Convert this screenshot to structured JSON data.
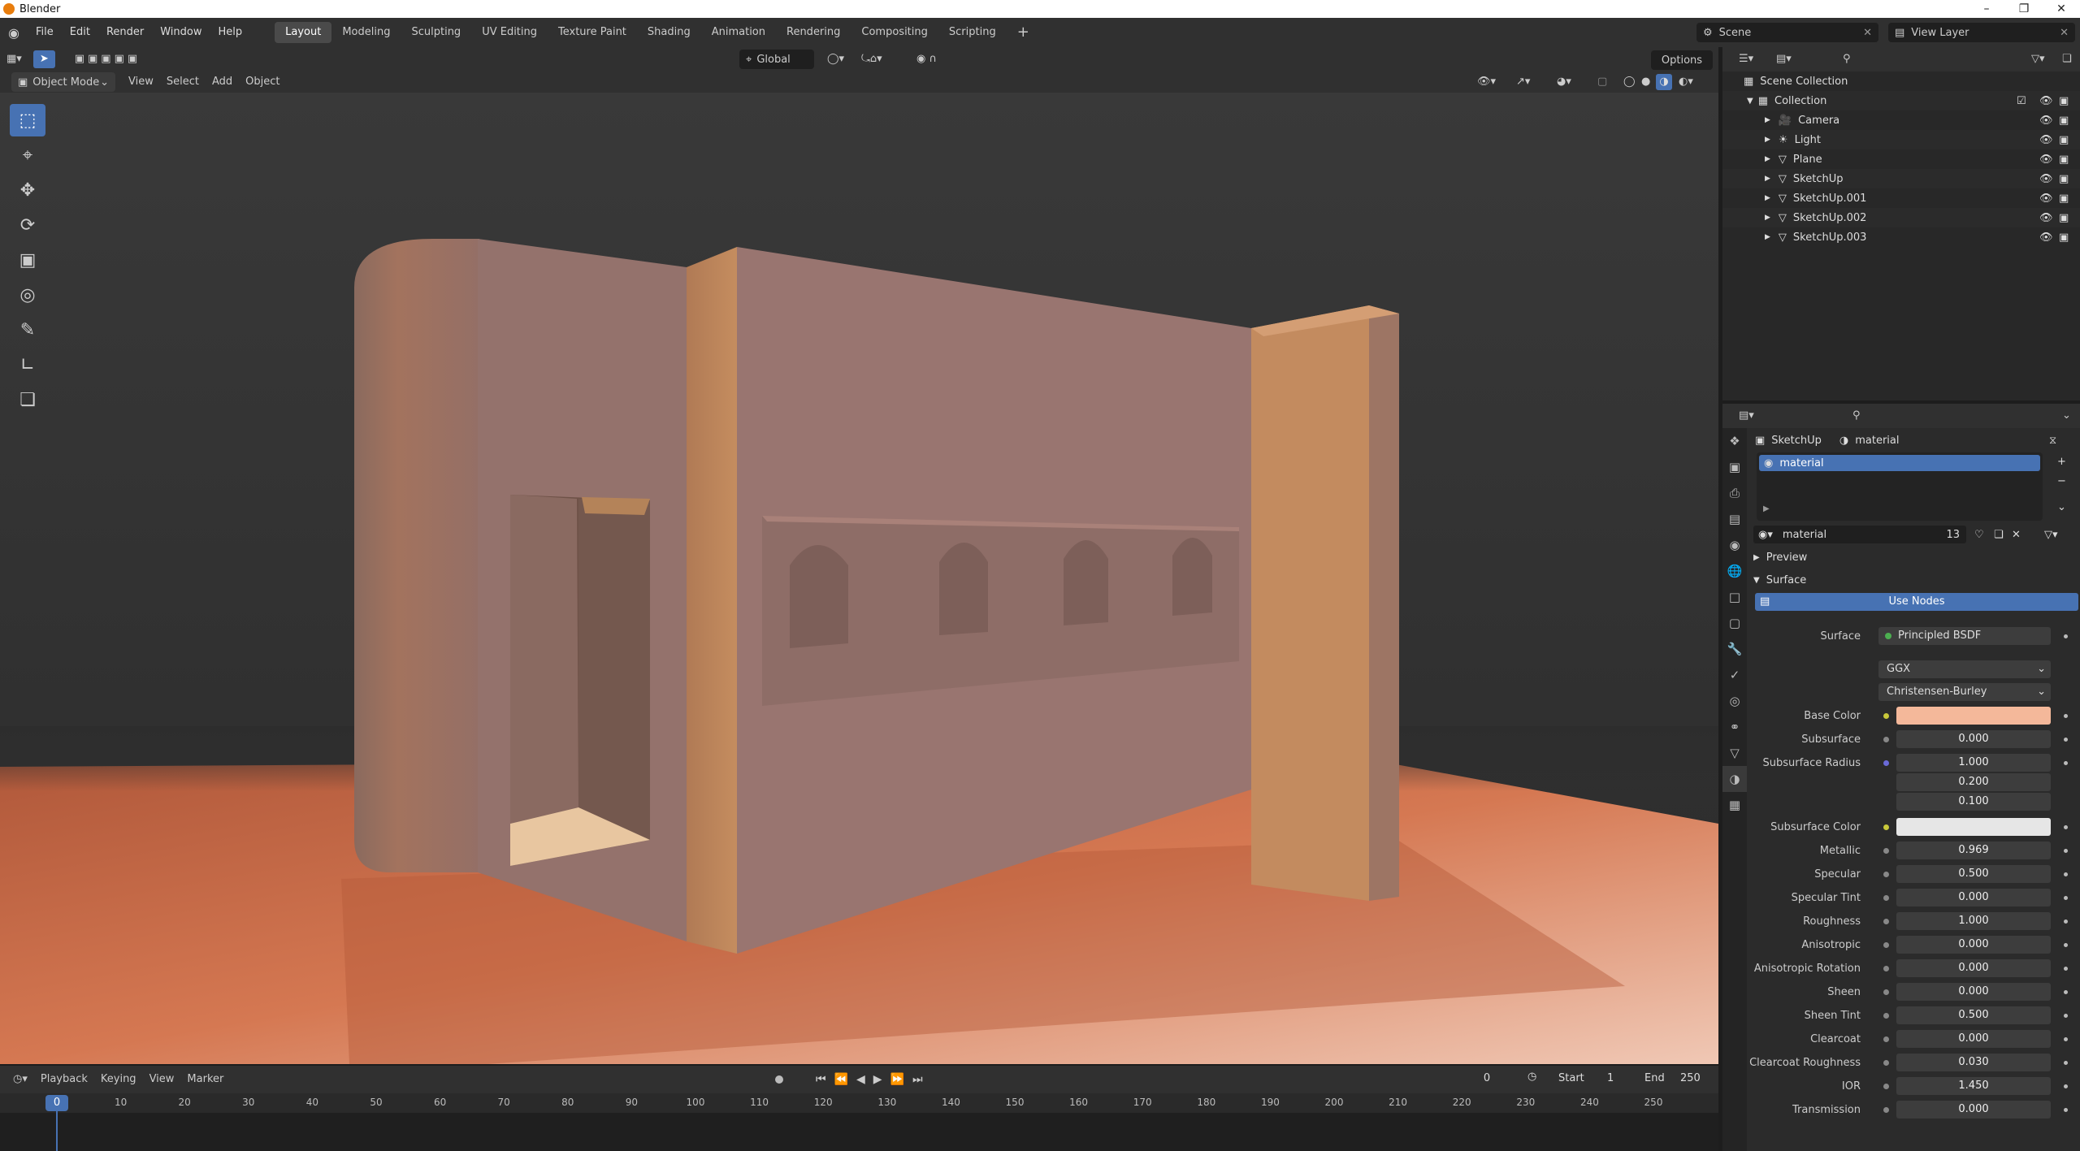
{
  "app": {
    "title": "Blender"
  },
  "menu": [
    "File",
    "Edit",
    "Render",
    "Window",
    "Help"
  ],
  "workspaces": [
    "Layout",
    "Modeling",
    "Sculpting",
    "UV Editing",
    "Texture Paint",
    "Shading",
    "Animation",
    "Rendering",
    "Compositing",
    "Scripting"
  ],
  "active_workspace": "Layout",
  "scene": {
    "label": "Scene",
    "view_layer": "View Layer"
  },
  "viewport": {
    "mode": "Object Mode",
    "menus": [
      "View",
      "Select",
      "Add",
      "Object"
    ],
    "transform_orientation": "Global",
    "options_label": "Options"
  },
  "timeline": {
    "menus": [
      "Playback",
      "Keying",
      "View",
      "Marker"
    ],
    "current_frame": "0",
    "start_label": "Start",
    "start_value": "1",
    "end_label": "End",
    "end_value": "250",
    "playhead": "0",
    "ticks": [
      "10",
      "20",
      "30",
      "40",
      "50",
      "60",
      "70",
      "80",
      "90",
      "100",
      "110",
      "120",
      "130",
      "140",
      "150",
      "160",
      "170",
      "180",
      "190",
      "200",
      "210",
      "220",
      "230",
      "240",
      "250"
    ]
  },
  "outliner": {
    "scene_collection": "Scene Collection",
    "collection": "Collection",
    "items": [
      "Camera",
      "Light",
      "Plane",
      "SketchUp",
      "SketchUp.001",
      "SketchUp.002",
      "SketchUp.003"
    ]
  },
  "properties": {
    "breadcrumb_object": "SketchUp",
    "breadcrumb_material": "material",
    "slot_name": "material",
    "material_name": "material",
    "users": "13",
    "panels": {
      "preview": "Preview",
      "surface": "Surface"
    },
    "use_nodes": "Use Nodes",
    "surface_label": "Surface",
    "surface_shader": "Principled BSDF",
    "distribution": "GGX",
    "subsurface_method": "Christensen-Burley",
    "base_color_label": "Base Color",
    "base_color": "#f4b89a",
    "subsurface_color_label": "Subsurface Color",
    "subsurface_color": "#e6e6e6",
    "subsurface_radius_label": "Subsurface Radius",
    "subsurface_radius": [
      "1.000",
      "0.200",
      "0.100"
    ],
    "fields": [
      {
        "label": "Subsurface",
        "value": "0.000"
      },
      {
        "label": "Metallic",
        "value": "0.969"
      },
      {
        "label": "Specular",
        "value": "0.500"
      },
      {
        "label": "Specular Tint",
        "value": "0.000"
      },
      {
        "label": "Roughness",
        "value": "1.000"
      },
      {
        "label": "Anisotropic",
        "value": "0.000"
      },
      {
        "label": "Anisotropic Rotation",
        "value": "0.000"
      },
      {
        "label": "Sheen",
        "value": "0.000"
      },
      {
        "label": "Sheen Tint",
        "value": "0.500"
      },
      {
        "label": "Clearcoat",
        "value": "0.000"
      },
      {
        "label": "Clearcoat Roughness",
        "value": "0.030"
      },
      {
        "label": "IOR",
        "value": "1.450"
      },
      {
        "label": "Transmission",
        "value": "0.000"
      }
    ]
  },
  "colors": {
    "accent": "#4772b3",
    "floor": "#d87a56",
    "wall": "#9a7770"
  }
}
